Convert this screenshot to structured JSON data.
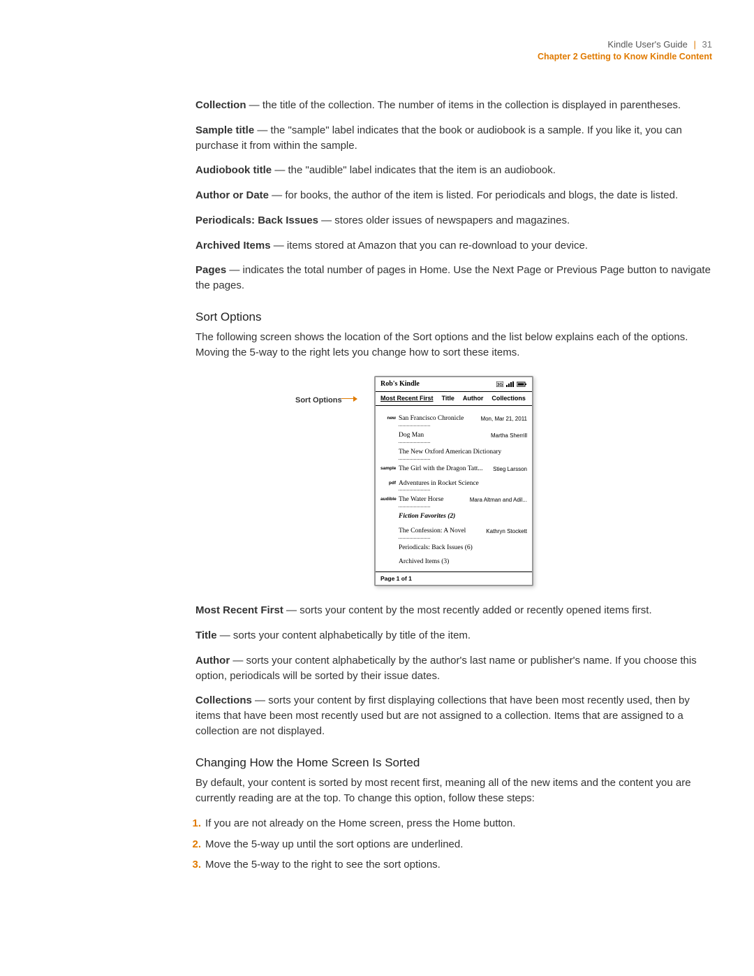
{
  "header": {
    "guide_title": "Kindle User's Guide",
    "page_number": "31",
    "chapter": "Chapter 2 Getting to Know Kindle Content"
  },
  "definitions": [
    {
      "term": "Collection",
      "text": " — the title of the collection. The number of items in the collection is displayed in parentheses."
    },
    {
      "term": "Sample title",
      "text": " — the \"sample\" label indicates that the book or audiobook is a sample. If you like it, you can purchase it from within the sample."
    },
    {
      "term": "Audiobook title",
      "text": " — the \"audible\" label indicates that the item is an audiobook."
    },
    {
      "term": "Author or Date",
      "text": " — for books, the author of the item is listed. For periodicals and blogs, the date is listed."
    },
    {
      "term": "Periodicals: Back Issues",
      "text": " — stores older issues of newspapers and magazines."
    },
    {
      "term": "Archived Items",
      "text": " — items stored at Amazon that you can re-download to your device."
    },
    {
      "term": "Pages",
      "text": " — indicates the total number of pages in Home. Use the Next Page or Previous Page button to navigate the pages."
    }
  ],
  "sort_options": {
    "heading": "Sort Options",
    "intro": "The following screen shows the location of the Sort options and the list below explains each of the options. Moving the 5-way to the right lets you change how to sort these items.",
    "figure_label": "Sort Options",
    "explanations": [
      {
        "term": "Most Recent First",
        "text": " — sorts your content by the most recently added or recently opened items first."
      },
      {
        "term": "Title",
        "text": " — sorts your content alphabetically by title of the item."
      },
      {
        "term": "Author",
        "text": " — sorts your content alphabetically by the author's last name or publisher's name. If you choose this option, periodicals will be sorted by their issue dates."
      },
      {
        "term": "Collections",
        "text": " — sorts your content by first displaying collections that have been most recently used, then by items that have been most recently used but are not assigned to a collection. Items that are assigned to a collection are not displayed."
      }
    ]
  },
  "kindle": {
    "device_name": "Rob's Kindle",
    "sort_tabs": [
      "Most Recent First",
      "Title",
      "Author",
      "Collections"
    ],
    "items": [
      {
        "badge": "new",
        "title": "San Francisco Chronicle",
        "meta": "Mon, Mar 21, 2011",
        "dots": true
      },
      {
        "badge": "",
        "title": "Dog Man",
        "meta": "Martha Sherrill",
        "dots": true
      },
      {
        "badge": "",
        "title": "The New Oxford American Dictionary",
        "meta": "",
        "dots": true
      },
      {
        "badge": "sample",
        "title": "The Girl with the Dragon Tatt...",
        "meta": "Stieg Larsson",
        "dots": false
      },
      {
        "badge": "pdf",
        "title": "Adventures in Rocket Science",
        "meta": "",
        "dots": true
      },
      {
        "badge": "audible",
        "title": "The Water Horse",
        "meta": "Mara Altman and Adil...",
        "dots": true
      },
      {
        "badge": "",
        "title": "Fiction Favorites (2)",
        "meta": "",
        "dots": false,
        "bolditalic": true
      },
      {
        "badge": "",
        "title": "The Confession: A Novel",
        "meta": "Kathryn Stockett",
        "dots": true
      },
      {
        "badge": "",
        "title": "Periodicals:  Back Issues (6)",
        "meta": "",
        "dots": false
      },
      {
        "badge": "",
        "title": "Archived Items (3)",
        "meta": "",
        "dots": false
      }
    ],
    "page_indicator": "Page 1 of 1"
  },
  "changing_sort": {
    "heading": "Changing How the Home Screen Is Sorted",
    "intro": "By default, your content is sorted by most recent first, meaning all of the new items and the content you are currently reading are at the top. To change this option, follow these steps:",
    "steps": [
      "If you are not already on the Home screen, press the Home button.",
      "Move the 5-way up until the sort options are underlined.",
      "Move the 5-way to the right to see the sort options."
    ]
  }
}
